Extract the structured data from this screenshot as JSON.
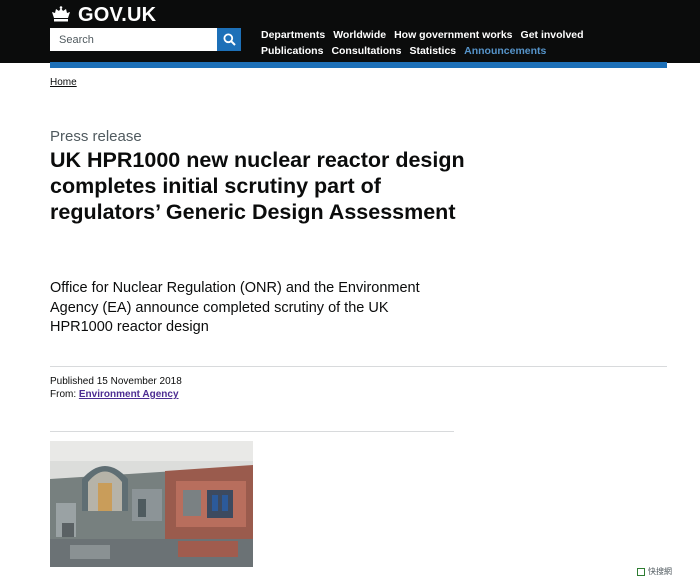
{
  "header": {
    "logo_text": "GOV.UK",
    "search": {
      "placeholder": "Search"
    },
    "nav_row1": [
      "Departments",
      "Worldwide",
      "How government works",
      "Get involved"
    ],
    "nav_row2": [
      "Publications",
      "Consultations",
      "Statistics",
      "Announcements"
    ],
    "active_nav": "Announcements"
  },
  "breadcrumb": {
    "home": "Home"
  },
  "article": {
    "type": "Press release",
    "title": "UK HPR1000 new nuclear reactor design completes initial scrutiny part of regulators’ Generic Design Assessment",
    "summary": "Office for Nuclear Regulation (ONR) and the Environment Agency (EA) announce completed scrutiny of the UK HPR1000 reactor design",
    "published_label": "Published",
    "published_date": "15 November 2018",
    "from_label": "From:",
    "from_org": "Environment Agency"
  },
  "watermark": {
    "text": "快搜網"
  },
  "colors": {
    "header_bg": "#0b0c0c",
    "accent_blue": "#1d70b8",
    "active_link": "#5694ca",
    "secondary_text": "#505a5f",
    "visited_link": "#4c2c92"
  }
}
